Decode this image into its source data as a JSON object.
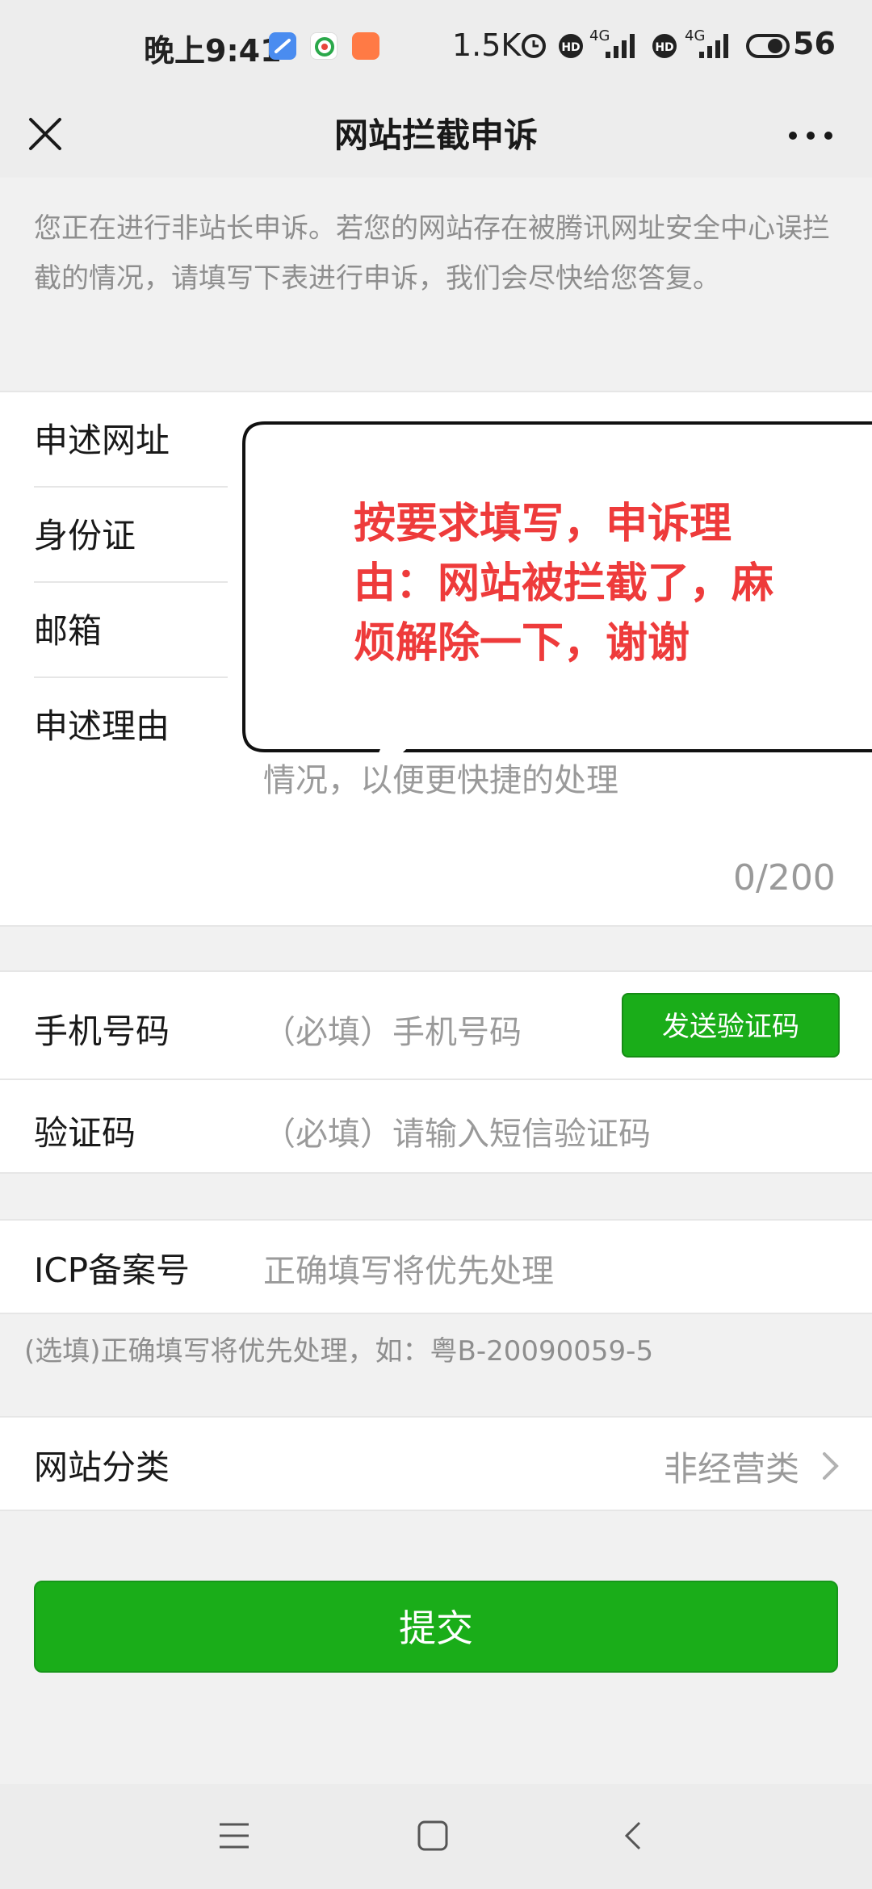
{
  "status_bar": {
    "time": "晚上9:41",
    "net_speed": "1.5K",
    "network_1": "4G",
    "network_2": "4G",
    "battery": "56"
  },
  "nav": {
    "title": "网站拦截申诉",
    "close_icon": "close-icon",
    "more_icon": "more-icon"
  },
  "notice": "您正在进行非站长申诉。若您的网站存在被腾讯网址安全中心误拦截的情况，请填写下表进行申诉，我们会尽快给您答复。",
  "form": {
    "url_label": "申述网址",
    "id_label": "身份证",
    "email_label": "邮箱",
    "reason_label": "申述理由",
    "reason_placeholder": "情况，以便更快捷的处理",
    "reason_counter": "0/200",
    "phone_label": "手机号码",
    "phone_placeholder": "（必填）手机号码",
    "send_code_button": "发送验证码",
    "code_label": "验证码",
    "code_placeholder": "（必填）请输入短信验证码",
    "icp_label": "ICP备案号",
    "icp_placeholder": "正确填写将优先处理",
    "icp_hint": "(选填)正确填写将优先处理，如：粤B-20090059-5",
    "category_label": "网站分类",
    "category_value": "非经营类",
    "submit_button": "提交"
  },
  "callout": {
    "text": "按要求填写，申诉理由：网站被拦截了，麻烦解除一下，谢谢",
    "text_color": "#ee3b3b"
  },
  "colors": {
    "brand_green": "#1aad19",
    "background_gray": "#ededed"
  }
}
